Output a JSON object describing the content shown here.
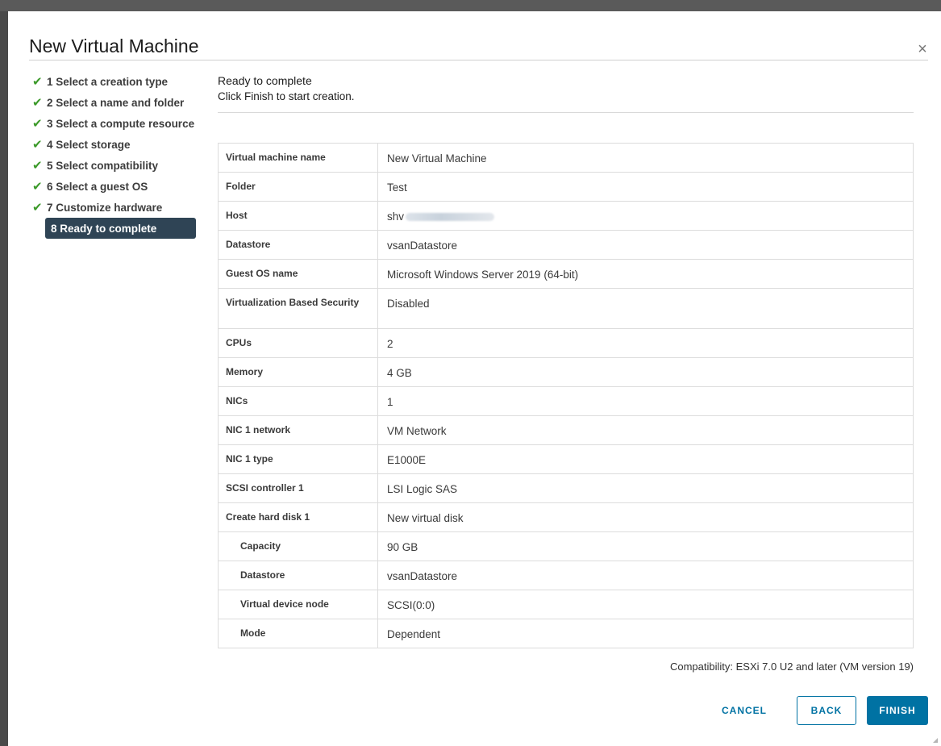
{
  "dialog": {
    "title": "New Virtual Machine",
    "close_label": "×"
  },
  "steps": [
    {
      "label": "1 Select a creation type",
      "done": true
    },
    {
      "label": "2 Select a name and folder",
      "done": true
    },
    {
      "label": "3 Select a compute resource",
      "done": true
    },
    {
      "label": "4 Select storage",
      "done": true
    },
    {
      "label": "5 Select compatibility",
      "done": true
    },
    {
      "label": "6 Select a guest OS",
      "done": true
    },
    {
      "label": "7 Customize hardware",
      "done": true
    },
    {
      "label": "8 Ready to complete",
      "done": false,
      "active": true
    }
  ],
  "step_check_glyph": "✔",
  "content": {
    "heading": "Ready to complete",
    "subheading": "Click Finish to start creation."
  },
  "summary": [
    {
      "key": "Virtual machine name",
      "value": "New Virtual Machine"
    },
    {
      "key": "Folder",
      "value": "Test"
    },
    {
      "key": "Host",
      "value": "shv",
      "redacted": true
    },
    {
      "key": "Datastore",
      "value": "vsanDatastore"
    },
    {
      "key": "Guest OS name",
      "value": "Microsoft Windows Server 2019 (64-bit)"
    },
    {
      "key": "Virtualization Based Security",
      "value": "Disabled",
      "tall": true
    },
    {
      "key": "CPUs",
      "value": "2"
    },
    {
      "key": "Memory",
      "value": "4 GB"
    },
    {
      "key": "NICs",
      "value": "1"
    },
    {
      "key": "NIC 1 network",
      "value": "VM Network"
    },
    {
      "key": "NIC 1 type",
      "value": "E1000E"
    },
    {
      "key": "SCSI controller 1",
      "value": "LSI Logic SAS"
    },
    {
      "key": "Create hard disk 1",
      "value": "New virtual disk"
    },
    {
      "key": "Capacity",
      "value": "90 GB",
      "indent": true
    },
    {
      "key": "Datastore",
      "value": "vsanDatastore",
      "indent": true
    },
    {
      "key": "Virtual device node",
      "value": "SCSI(0:0)",
      "indent": true
    },
    {
      "key": "Mode",
      "value": "Dependent",
      "indent": true
    }
  ],
  "compatibility": "Compatibility: ESXi 7.0 U2 and later (VM version 19)",
  "buttons": {
    "cancel": "CANCEL",
    "back": "BACK",
    "finish": "FINISH"
  },
  "colors": {
    "accent": "#0072a3",
    "active_step_bg": "#2f4455",
    "check": "#3c9a2a"
  }
}
